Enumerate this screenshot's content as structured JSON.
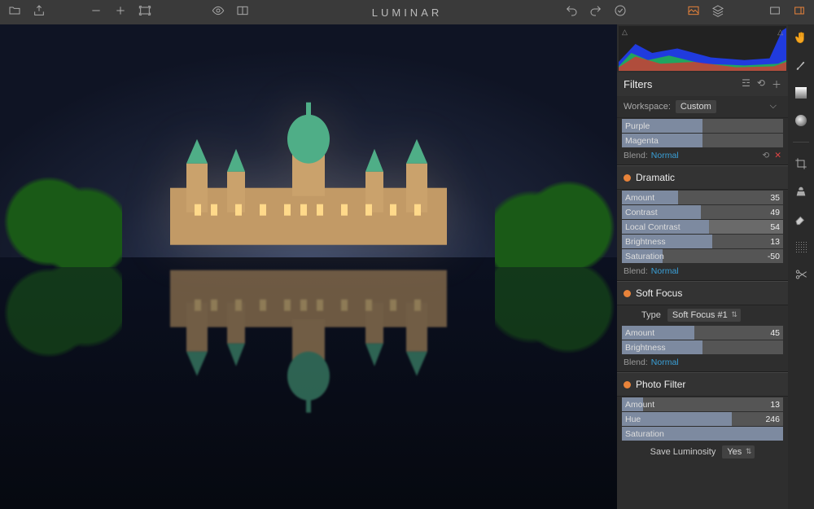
{
  "app": {
    "title": "LUMINAR"
  },
  "panel": {
    "filters_title": "Filters",
    "workspace_label": "Workspace:",
    "workspace_value": "Custom",
    "color_sliders": [
      {
        "label": "Purple",
        "fill": 50
      },
      {
        "label": "Magenta",
        "fill": 50
      }
    ],
    "top_blend": {
      "label": "Blend:",
      "value": "Normal"
    },
    "groups": [
      {
        "title": "Dramatic",
        "sliders": [
          {
            "label": "Amount",
            "value": 35,
            "fill": 35
          },
          {
            "label": "Contrast",
            "value": 49,
            "fill": 49
          },
          {
            "label": "Local Contrast",
            "value": 54,
            "fill": 54,
            "highlight": true
          },
          {
            "label": "Brightness",
            "value": 13,
            "fill": 56
          },
          {
            "label": "Saturation",
            "value": -50,
            "fill": 25
          }
        ],
        "blend": {
          "label": "Blend:",
          "value": "Normal"
        }
      },
      {
        "title": "Soft Focus",
        "type_label": "Type",
        "type_value": "Soft Focus #1",
        "sliders": [
          {
            "label": "Amount",
            "value": 45,
            "fill": 45
          },
          {
            "label": "Brightness",
            "value": "",
            "fill": 50
          }
        ],
        "blend": {
          "label": "Blend:",
          "value": "Normal"
        }
      },
      {
        "title": "Photo Filter",
        "sliders": [
          {
            "label": "Amount",
            "value": 13,
            "fill": 13
          },
          {
            "label": "Hue",
            "value": 246,
            "fill": 68
          },
          {
            "label": "Saturation",
            "value": "",
            "fill": 100
          }
        ],
        "save_luminosity_label": "Save Luminosity",
        "save_luminosity_value": "Yes"
      }
    ]
  }
}
